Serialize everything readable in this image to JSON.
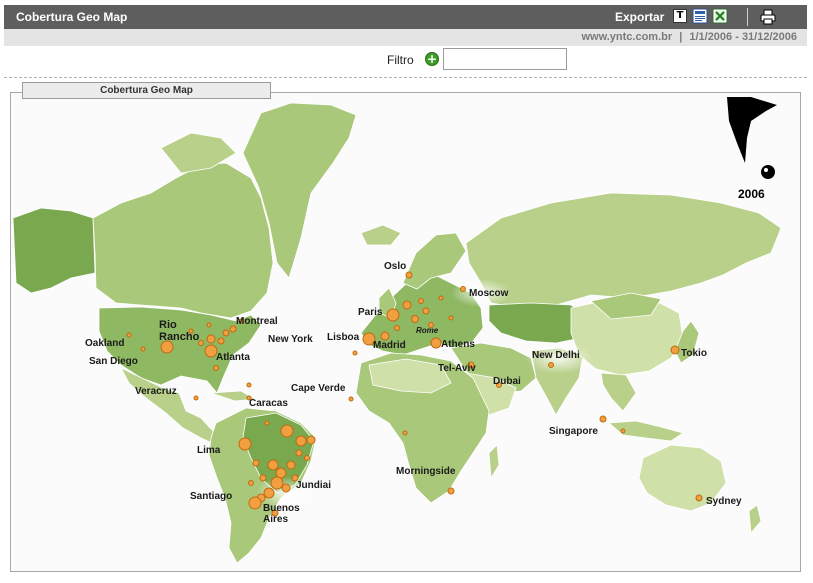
{
  "header": {
    "title": "Cobertura Geo Map",
    "export_label": "Exportar",
    "export_text_icon": "T"
  },
  "subheader": {
    "site": "www.yntc.com.br",
    "date_range": "1/1/2006 - 31/12/2006",
    "separator": "|"
  },
  "filter": {
    "label": "Filtro",
    "value": "",
    "placeholder": ""
  },
  "panel": {
    "title": "Cobertura Geo Map",
    "logo_year": "2006"
  },
  "cities": [
    {
      "name": "Oslo"
    },
    {
      "name": "Moscow"
    },
    {
      "name": "Paris"
    },
    {
      "name": "Rome"
    },
    {
      "name": "Lisboa"
    },
    {
      "name": "Madrid"
    },
    {
      "name": "Athens"
    },
    {
      "name": "Tel-Aviv"
    },
    {
      "name": "Dubai"
    },
    {
      "name": "New Delhi"
    },
    {
      "name": "Tokio"
    },
    {
      "name": "Singapore"
    },
    {
      "name": "Sydney"
    },
    {
      "name": "Morningside"
    },
    {
      "name": "Cape Verde"
    },
    {
      "name": "Montreal"
    },
    {
      "name": "New York"
    },
    {
      "name": "Rio Rancho"
    },
    {
      "name": "Atlanta"
    },
    {
      "name": "Oakland"
    },
    {
      "name": "San Diego"
    },
    {
      "name": "Veracruz"
    },
    {
      "name": "Caracas"
    },
    {
      "name": "Lima"
    },
    {
      "name": "Santiago"
    },
    {
      "name": "Buenos Aires"
    },
    {
      "name": "Jundiai"
    }
  ],
  "colors": {
    "header_bg": "#5e5e5e",
    "land_light": "#cfe0a8",
    "land_mid": "#a9c87a",
    "land_dark": "#7aa84e",
    "marker": "#f0a040"
  }
}
